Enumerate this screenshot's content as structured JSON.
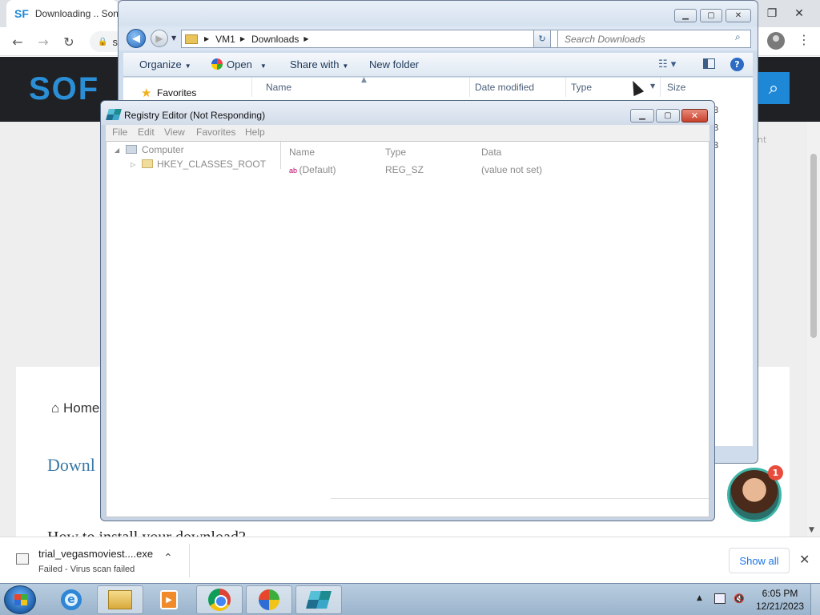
{
  "browser": {
    "tab_title": "Downloading .. Son",
    "tab_favicon": "SF",
    "omnibox_text": "s",
    "window_controls": [
      "restore-icon",
      "close-icon"
    ]
  },
  "website": {
    "logo_text": "SOF",
    "breadcrumb_home": "Home",
    "heading": "Downl",
    "subheading": "How to install your download?",
    "side_text": "nt",
    "chat_badge": "1"
  },
  "download_bar": {
    "file_name": "trial_vegasmoviest....exe",
    "status": "Failed - Virus scan failed",
    "show_all": "Show all"
  },
  "explorer": {
    "breadcrumb": [
      "VM1",
      "Downloads"
    ],
    "search_placeholder": "Search Downloads",
    "commands": {
      "organize": "Organize",
      "open": "Open",
      "share_with": "Share with",
      "new_folder": "New folder"
    },
    "nav_favorites": "Favorites",
    "columns": [
      "Name",
      "Date modified",
      "Type",
      "Size"
    ],
    "size_fragments": [
      "B",
      "B",
      "B"
    ]
  },
  "regedit": {
    "title": "Registry Editor (Not Responding)",
    "menu": [
      "File",
      "Edit",
      "View",
      "Favorites",
      "Help"
    ],
    "tree": [
      "Computer",
      "HKEY_CLASSES_ROOT"
    ],
    "columns": [
      "Name",
      "Type",
      "Data"
    ],
    "rows": [
      {
        "name": "(Default)",
        "type": "REG_SZ",
        "data": "(value not set)"
      }
    ]
  },
  "taskbar": {
    "time": "6:05 PM",
    "date": "12/21/2023"
  },
  "colors": {
    "chrome_tabbar": "#dee1e6",
    "site_header": "#1f2124",
    "site_accent": "#1e88d6",
    "aero_frame": "#cfdcec",
    "close_red": "#c7412c",
    "taskbar": "#9ab4cc"
  }
}
